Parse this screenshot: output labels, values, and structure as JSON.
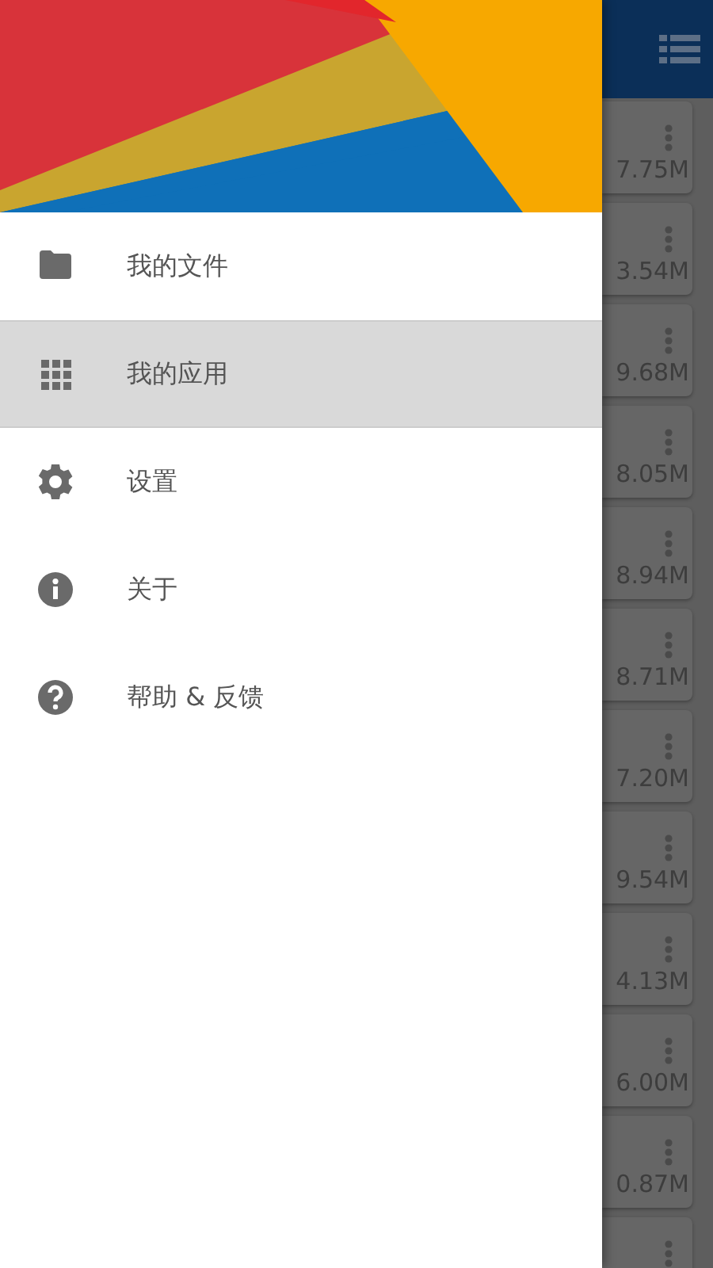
{
  "drawer": {
    "items": [
      {
        "label": "我的文件",
        "kind": "folder",
        "selected": false
      },
      {
        "label": "我的应用",
        "kind": "grid",
        "selected": true
      },
      {
        "label": "设置",
        "kind": "gear",
        "selected": false
      },
      {
        "label": "关于",
        "kind": "info",
        "selected": false
      },
      {
        "label": "帮助 & 反馈",
        "kind": "help",
        "selected": false
      }
    ]
  },
  "apps": [
    {
      "size": "7.75M"
    },
    {
      "size": "3.54M"
    },
    {
      "size": "9.68M"
    },
    {
      "size": "8.05M"
    },
    {
      "size": "8.94M"
    },
    {
      "size": "8.71M"
    },
    {
      "size": "7.20M"
    },
    {
      "size": "9.54M"
    },
    {
      "size": "4.13M"
    },
    {
      "size": "6.00M"
    },
    {
      "size": "0.87M"
    }
  ]
}
